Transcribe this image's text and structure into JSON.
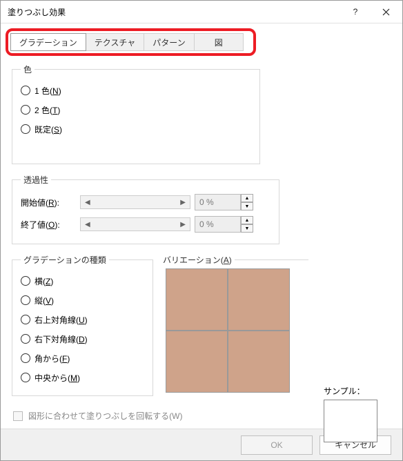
{
  "titlebar": {
    "title": "塗りつぶし効果"
  },
  "tabs": [
    {
      "label": "グラデーション",
      "active": true
    },
    {
      "label": "テクスチャ"
    },
    {
      "label": "パターン"
    },
    {
      "label": "図"
    }
  ],
  "colorGroup": {
    "legend": "色",
    "opt1": {
      "label": "1 色(",
      "accel": "N",
      "tail": ")"
    },
    "opt2": {
      "label": "2 色(",
      "accel": "T",
      "tail": ")"
    },
    "opt3": {
      "label": "既定(",
      "accel": "S",
      "tail": ")"
    }
  },
  "transparency": {
    "legend": "透過性",
    "start": {
      "label": "開始値(",
      "accel": "R",
      "tail": "):",
      "value": "0 %"
    },
    "end": {
      "label": "終了値(",
      "accel": "O",
      "tail": "):",
      "value": "0 %"
    }
  },
  "gradType": {
    "legend": "グラデーションの種類",
    "o1": {
      "label": "横(",
      "accel": "Z",
      "tail": ")"
    },
    "o2": {
      "label": "縦(",
      "accel": "V",
      "tail": ")"
    },
    "o3": {
      "label": "右上対角線(",
      "accel": "U",
      "tail": ")"
    },
    "o4": {
      "label": "右下対角線(",
      "accel": "D",
      "tail": ")"
    },
    "o5": {
      "label": "角から(",
      "accel": "F",
      "tail": ")"
    },
    "o6": {
      "label": "中央から(",
      "accel": "M",
      "tail": ")"
    }
  },
  "variations": {
    "legend": "バリエーション(",
    "accel": "A",
    "tail": ")"
  },
  "sample": {
    "label": "サンプル："
  },
  "rotate": {
    "label": "図形に合わせて塗りつぶしを回転する(W)"
  },
  "footer": {
    "ok": "OK",
    "cancel": "キャンセル"
  }
}
